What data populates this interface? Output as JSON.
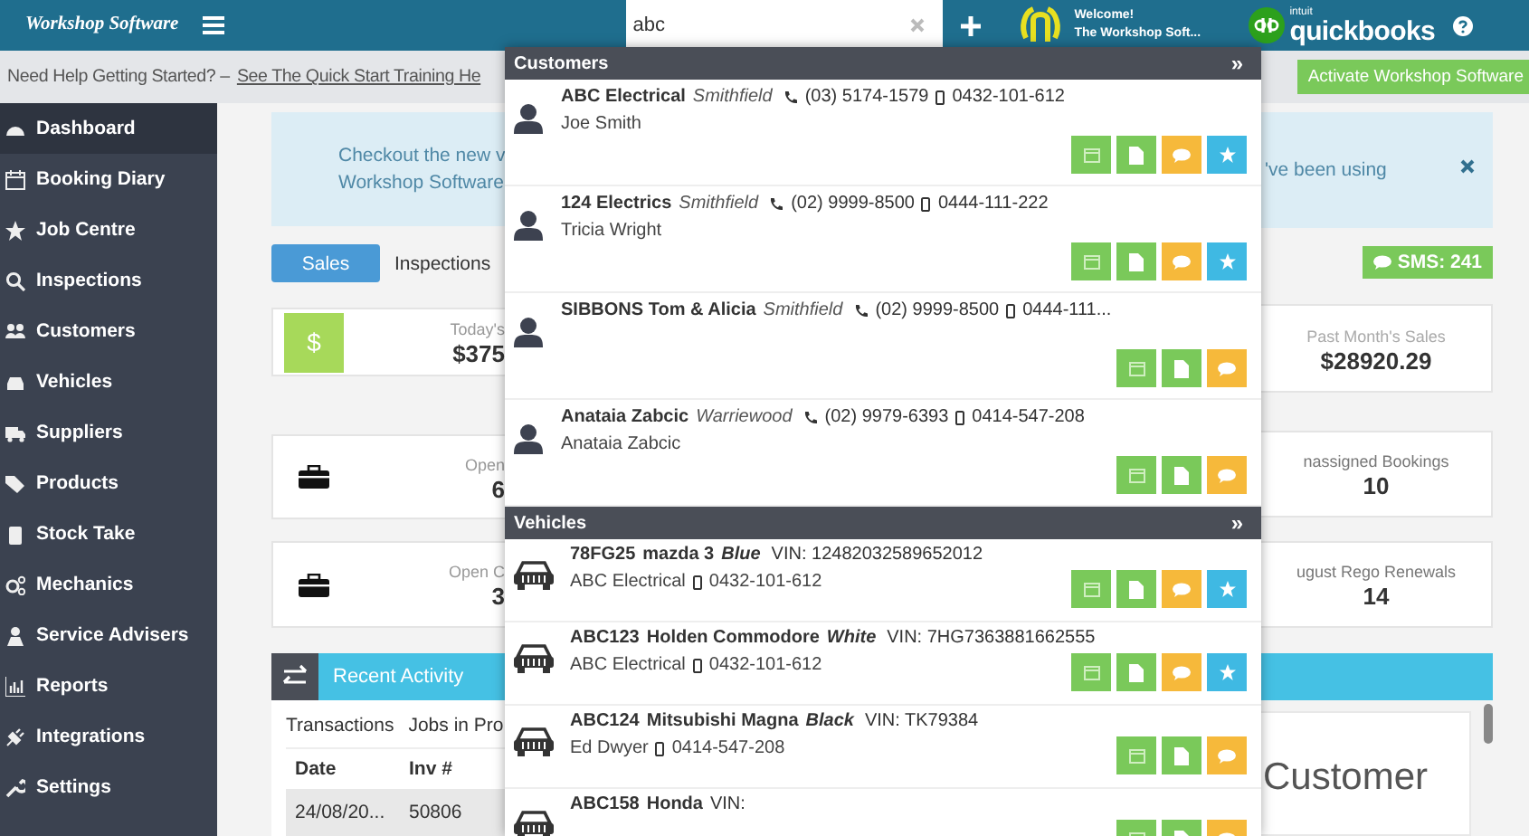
{
  "topbar": {
    "logo": "Workshop Software",
    "search": {
      "value": "abc"
    },
    "welcome": "Welcome!",
    "account": "The Workshop Soft...",
    "qb_small": "intuit",
    "qb_name": "quickbooks"
  },
  "help_bar": {
    "text": "Need Help Getting Started? –",
    "link": "See The Quick Start Training He",
    "activate": "Activate Workshop Software"
  },
  "sidebar": {
    "items": [
      {
        "label": "Dashboard",
        "selected": true
      },
      {
        "label": "Booking Diary",
        "selected": false
      },
      {
        "label": "Job Centre",
        "selected": false
      },
      {
        "label": "Inspections",
        "selected": false
      },
      {
        "label": "Customers",
        "selected": false
      },
      {
        "label": "Vehicles",
        "selected": false
      },
      {
        "label": "Suppliers",
        "selected": false
      },
      {
        "label": "Products",
        "selected": false
      },
      {
        "label": "Stock Take",
        "selected": false
      },
      {
        "label": "Mechanics",
        "selected": false
      },
      {
        "label": "Service Advisers",
        "selected": false
      },
      {
        "label": "Reports",
        "selected": false
      },
      {
        "label": "Integrations",
        "selected": false
      },
      {
        "label": "Settings",
        "selected": false
      }
    ]
  },
  "notice": {
    "left_lines": [
      "Checkout the new v",
      "Workshop Software"
    ],
    "right_text": "'ve been using"
  },
  "tabs": [
    {
      "label": "Sales",
      "selected": true
    },
    {
      "label": "Inspections",
      "selected": false
    }
  ],
  "sms": "SMS: 241",
  "left_cards": [
    {
      "kind": "money",
      "icon": "$",
      "label": "Today's",
      "value": "$375"
    },
    {
      "kind": "briefcase",
      "label": "Open",
      "value": "6"
    },
    {
      "kind": "briefcase",
      "label": "Open C",
      "value": "3"
    }
  ],
  "right_cards": [
    {
      "label": "Past Month's Sales",
      "value": "$28920.29"
    },
    {
      "label": "nassigned Bookings",
      "value": "10"
    },
    {
      "label": "ugust Rego Renewals",
      "value": "14"
    }
  ],
  "activity": {
    "title": "Recent Activity",
    "tabs": [
      "Transactions",
      "Jobs in Pro"
    ],
    "columns": [
      "Date",
      "Inv #"
    ],
    "rows": [
      [
        "24/08/20...",
        "50806"
      ]
    ],
    "side_text": "Customer"
  },
  "dropdown": {
    "more": "»",
    "customers_title": "Customers",
    "customers": [
      {
        "name": "ABC Electrical",
        "suburb": "Smithfield",
        "phone": "(03) 5174-1579",
        "mobile": "0432-101-612",
        "contact": "Joe Smith",
        "actions": [
          {
            "kind": "calendar"
          },
          {
            "kind": "document"
          },
          {
            "kind": "message"
          },
          {
            "kind": "star"
          }
        ]
      },
      {
        "name": "124 Electrics",
        "suburb": "Smithfield",
        "phone": "(02) 9999-8500",
        "mobile": "0444-111-222",
        "contact": "Tricia Wright",
        "actions": [
          {
            "kind": "calendar"
          },
          {
            "kind": "document"
          },
          {
            "kind": "message"
          },
          {
            "kind": "star"
          }
        ]
      },
      {
        "name": "SIBBONS Tom & Alicia",
        "suburb": "Smithfield",
        "phone": "(02) 9999-8500",
        "mobile": "0444-111...",
        "actions": [
          {
            "kind": "calendar"
          },
          {
            "kind": "document"
          },
          {
            "kind": "message"
          }
        ]
      },
      {
        "name": "Anataia Zabcic",
        "suburb": "Warriewood",
        "phone": "(02) 9979-6393",
        "mobile": "0414-547-208",
        "contact": "Anataia Zabcic",
        "actions": [
          {
            "kind": "calendar"
          },
          {
            "kind": "document"
          },
          {
            "kind": "message"
          }
        ]
      }
    ],
    "vehicles_title": "Vehicles",
    "vehicles": [
      {
        "rego": "78FG25",
        "model": "mazda 3",
        "colour": "Blue",
        "vin": "VIN: 12482032589652012",
        "owner": "ABC Electrical",
        "mobile": "0432-101-612",
        "actions": [
          {
            "kind": "calendar"
          },
          {
            "kind": "document"
          },
          {
            "kind": "message"
          },
          {
            "kind": "star"
          }
        ]
      },
      {
        "rego": "ABC123",
        "model": "Holden Commodore",
        "colour": "White",
        "vin": "VIN: 7HG7363881662555",
        "owner": "ABC Electrical",
        "mobile": "0432-101-612",
        "actions": [
          {
            "kind": "calendar"
          },
          {
            "kind": "document"
          },
          {
            "kind": "message"
          },
          {
            "kind": "star"
          }
        ]
      },
      {
        "rego": "ABC124",
        "model": "Mitsubishi Magna",
        "colour": "Black",
        "vin": "VIN: TK79384",
        "owner": "Ed Dwyer",
        "mobile": "0414-547-208",
        "actions": [
          {
            "kind": "calendar"
          },
          {
            "kind": "document"
          },
          {
            "kind": "message"
          }
        ]
      },
      {
        "rego": "ABC158",
        "model": "Honda",
        "vin": "VIN:",
        "actions": [
          {
            "kind": "calendar"
          },
          {
            "kind": "document"
          },
          {
            "kind": "message"
          }
        ]
      }
    ]
  }
}
